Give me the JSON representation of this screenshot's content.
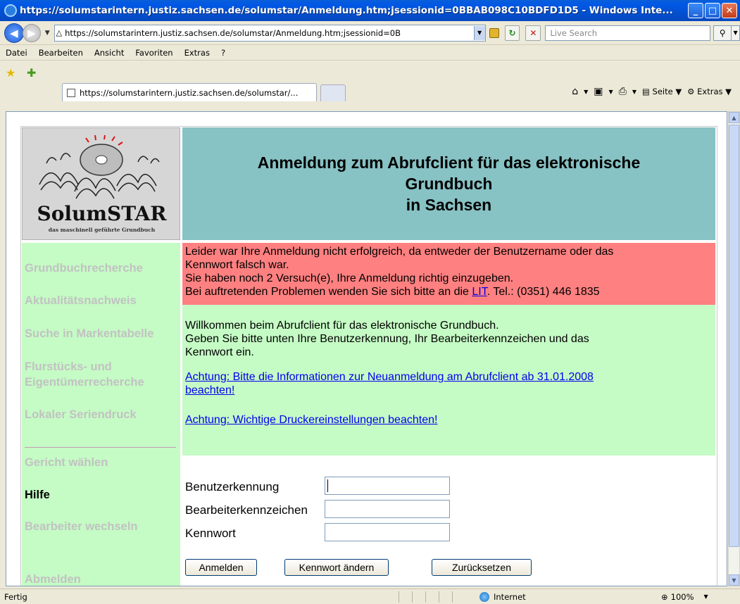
{
  "window": {
    "title": "https://solumstarintern.justiz.sachsen.de/solumstar/Anmeldung.htm;jsessionid=0BBAB098C10BDFD1D5 - Windows Inte...",
    "minimize": "_",
    "maximize": "□",
    "close": "✕"
  },
  "address_bar": {
    "url": "https://solumstarintern.justiz.sachsen.de/solumstar/Anmeldung.htm;jsessionid=0B",
    "search_placeholder": "Live Search"
  },
  "menu": [
    "Datei",
    "Bearbeiten",
    "Ansicht",
    "Favoriten",
    "Extras",
    "?"
  ],
  "tabs": [
    {
      "label": "https://solumstarintern.justiz.sachsen.de/solumstar/..."
    }
  ],
  "command_bar": {
    "page_label": "Seite",
    "extras_label": "Extras"
  },
  "page": {
    "logo": {
      "title": "SolumSTAR",
      "subtitle": "das maschinell geführte Grundbuch"
    },
    "header": {
      "line1": "Anmeldung zum Abrufclient für das elektronische",
      "line2": "Grundbuch",
      "line3": "in Sachsen"
    },
    "nav": [
      {
        "label": "Grundbuchrecherche",
        "active": false
      },
      {
        "label": "Aktualitätsnachweis",
        "active": false
      },
      {
        "label": "Suche in Markentabelle",
        "active": false
      },
      {
        "label": "Flurstücks- und",
        "active": false
      },
      {
        "label": "Eigentümerrecherche",
        "active": false
      },
      {
        "label": "Lokaler Seriendruck",
        "active": false
      },
      {
        "label": "Gericht wählen",
        "active": false
      },
      {
        "label": "Hilfe",
        "active": true
      },
      {
        "label": "Bearbeiter wechseln",
        "active": false
      },
      {
        "label": "Abmelden",
        "active": false
      }
    ],
    "error": {
      "line1": "Leider war Ihre Anmeldung nicht erfolgreich, da entweder der Benutzername oder das",
      "line2": "Kennwort falsch war.",
      "line3": "Sie haben noch 2 Versuch(e), Ihre Anmeldung richtig einzugeben.",
      "line4_prefix": "Bei auftretenden Problemen wenden Sie sich bitte an die ",
      "line4_link": "LIT",
      "line4_suffix": ". Tel.: (0351) 446 1835"
    },
    "info": {
      "line1": "Willkommen beim Abrufclient für das elektronische Grundbuch.",
      "line2": "Geben Sie bitte unten Ihre Benutzerkennung, Ihr Bearbeiterkennzeichen und das",
      "line3": "Kennwort ein.",
      "link1_line1": "Achtung: Bitte die Informationen zur Neuanmeldung am Abrufclient ab 31.01.2008",
      "link1_line2": "beachten!",
      "link2": "Achtung: Wichtige Druckereinstellungen beachten!"
    },
    "form": {
      "user_label": "Benutzerkennung",
      "user_value": "",
      "editor_label": "Bearbeiterkennzeichen",
      "editor_value": "",
      "password_label": "Kennwort",
      "password_value": "",
      "login_button": "Anmelden",
      "change_password_button": "Kennwort ändern",
      "reset_button": "Zurücksetzen"
    }
  },
  "status_bar": {
    "status": "Fertig",
    "zone": "Internet",
    "zoom": "100%"
  }
}
